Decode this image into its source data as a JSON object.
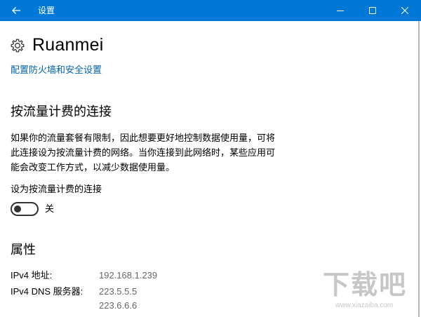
{
  "window": {
    "title": "设置"
  },
  "header": {
    "page_title": "Ruanmei",
    "firewall_link": "配置防火墙和安全设置"
  },
  "metered": {
    "heading": "按流量计费的连接",
    "description": [
      "如果你的流量套餐有限制，因此想要更好地控制数据使用量，可将",
      "此连接设为按流量计费的网络。当你连接到此网络时，某些应用可",
      "能会改变工作方式，以减少数据使用量。"
    ],
    "toggle_label": "设为按流量计费的连接",
    "toggle_state": "关",
    "toggle_on": false
  },
  "properties": {
    "heading": "属性",
    "ipv4_label": "IPv4 地址:",
    "ipv4_value": "192.168.1.239",
    "dns_label": "IPv4 DNS 服务器:",
    "dns_values": [
      "223.5.5.5",
      "223.6.6.6"
    ]
  },
  "watermark": {
    "text": "下载吧",
    "url": "www.xiazaiba.com"
  },
  "colors": {
    "titlebar": "#0078d7",
    "link": "#0063b1",
    "value_text": "#666666"
  }
}
